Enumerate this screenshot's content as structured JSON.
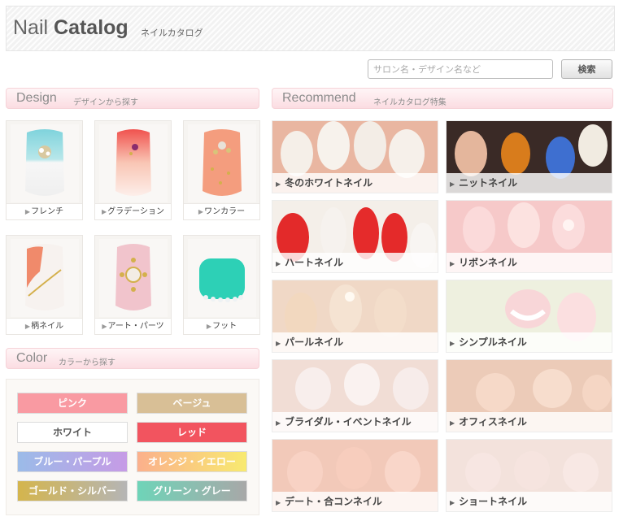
{
  "header": {
    "title_light": "Nail ",
    "title_bold": "Catalog",
    "subtitle": "ネイルカタログ"
  },
  "search": {
    "placeholder": "サロン名・デザイン名など",
    "button_label": "検索"
  },
  "design_section": {
    "title": "Design",
    "subtitle": "デザインから探す",
    "items": [
      {
        "label": "フレンチ"
      },
      {
        "label": "グラデーション"
      },
      {
        "label": "ワンカラー"
      },
      {
        "label": "柄ネイル"
      },
      {
        "label": "アート・パーツ"
      },
      {
        "label": "フット"
      }
    ]
  },
  "color_section": {
    "title": "Color",
    "subtitle": "カラーから探す",
    "items": [
      {
        "label": "ピンク",
        "color": "#f99aa2"
      },
      {
        "label": "ベージュ",
        "color": "#d8bf96"
      },
      {
        "label": "ホワイト",
        "color": "#ffffff"
      },
      {
        "label": "レッド",
        "color": "#f2545f"
      },
      {
        "label": "ブルー・パープル",
        "color_a": "#9bbbe8",
        "color_b": "#c69be6"
      },
      {
        "label": "オレンジ・イエロー",
        "color_a": "#fbb08c",
        "color_b": "#f8ea70"
      },
      {
        "label": "ゴールド・シルバー",
        "color_a": "#d4b54d",
        "color_b": "#b5b5b5"
      },
      {
        "label": "グリーン・グレー",
        "color_a": "#6ed4b8",
        "color_b": "#a8a8a8"
      }
    ]
  },
  "recommend_section": {
    "title": "Recommend",
    "subtitle": "ネイルカタログ特集",
    "items": [
      {
        "label": "冬のホワイトネイル"
      },
      {
        "label": "ニットネイル"
      },
      {
        "label": "ハートネイル"
      },
      {
        "label": "リボンネイル"
      },
      {
        "label": "パールネイル"
      },
      {
        "label": "シンプルネイル"
      },
      {
        "label": "ブライダル・イベントネイル"
      },
      {
        "label": "オフィスネイル"
      },
      {
        "label": "デート・合コンネイル"
      },
      {
        "label": "ショートネイル"
      }
    ]
  }
}
